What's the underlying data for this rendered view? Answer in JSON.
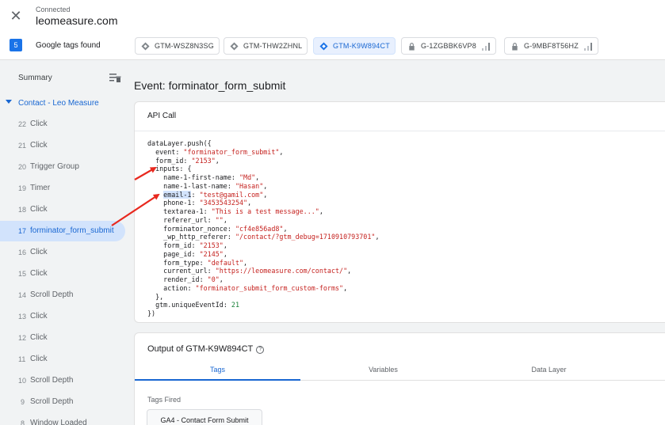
{
  "header": {
    "status": "Connected",
    "domain": "leomeasure.com"
  },
  "tags_bar": {
    "count": "5",
    "label": "Google tags found",
    "chips": [
      {
        "label": "GTM-WSZ8N3SG",
        "kind": "gtm",
        "active": false
      },
      {
        "label": "GTM-THW2ZHNL",
        "kind": "gtm",
        "active": false
      },
      {
        "label": "GTM-K9W894CT",
        "kind": "gtm",
        "active": true
      },
      {
        "label": "G-1ZGBBK6VP8",
        "kind": "ga",
        "active": false
      },
      {
        "label": "G-9MBF8T56HZ",
        "kind": "ga",
        "active": false
      }
    ]
  },
  "sidebar": {
    "summary_label": "Summary",
    "group_label": "Contact - Leo Measure",
    "events": [
      {
        "num": "22",
        "label": "Click"
      },
      {
        "num": "21",
        "label": "Click"
      },
      {
        "num": "20",
        "label": "Trigger Group"
      },
      {
        "num": "19",
        "label": "Timer"
      },
      {
        "num": "18",
        "label": "Click"
      },
      {
        "num": "17",
        "label": "forminator_form_submit",
        "active": true
      },
      {
        "num": "16",
        "label": "Click"
      },
      {
        "num": "15",
        "label": "Click"
      },
      {
        "num": "14",
        "label": "Scroll Depth"
      },
      {
        "num": "13",
        "label": "Click"
      },
      {
        "num": "12",
        "label": "Click"
      },
      {
        "num": "11",
        "label": "Click"
      },
      {
        "num": "10",
        "label": "Scroll Depth"
      },
      {
        "num": "9",
        "label": "Scroll Depth"
      },
      {
        "num": "8",
        "label": "Window Loaded"
      }
    ]
  },
  "main": {
    "event_title": "Event: forminator_form_submit",
    "api_call_label": "API Call",
    "code": {
      "open": "dataLayer.push({",
      "event_key": "event",
      "event_val": "\"forminator_form_submit\"",
      "form_id_key": "form_id",
      "form_id_val": "\"2153\"",
      "inputs_key": "inputs",
      "fields": [
        {
          "key": "name-1-first-name",
          "val": "\"Md\""
        },
        {
          "key": "name-1-last-name",
          "val": "\"Hasan\""
        },
        {
          "key": "email-1",
          "val": "\"test@gamil.com\""
        },
        {
          "key": "phone-1",
          "val": "\"3453543254\""
        },
        {
          "key": "textarea-1",
          "val": "\"This is a test message...\""
        },
        {
          "key": "referer_url",
          "val": "\"\""
        },
        {
          "key": "forminator_nonce",
          "val": "\"cf4e856ad8\""
        },
        {
          "key": "_wp_http_referer",
          "val": "\"/contact/?gtm_debug=1710910793701\""
        },
        {
          "key": "form_id",
          "val": "\"2153\""
        },
        {
          "key": "page_id",
          "val": "\"2145\""
        },
        {
          "key": "form_type",
          "val": "\"default\""
        },
        {
          "key": "current_url",
          "val": "\"https://leomeasure.com/contact/\""
        },
        {
          "key": "render_id",
          "val": "\"0\""
        },
        {
          "key": "action",
          "val": "\"forminator_submit_form_custom-forms\""
        }
      ],
      "unique_key": "gtm.uniqueEventId",
      "unique_val": "21",
      "close": "})"
    },
    "output_title": "Output of GTM-K9W894CT",
    "tabs": [
      "Tags",
      "Variables",
      "Data Layer"
    ],
    "tags_fired_label": "Tags Fired",
    "fired_tag": "GA4 - Contact Form Submit"
  },
  "colors": {
    "accent": "#1a73e8",
    "active_text": "#1967d2",
    "string": "#c5221f",
    "number": "#188038",
    "arrow": "#e8281e"
  }
}
